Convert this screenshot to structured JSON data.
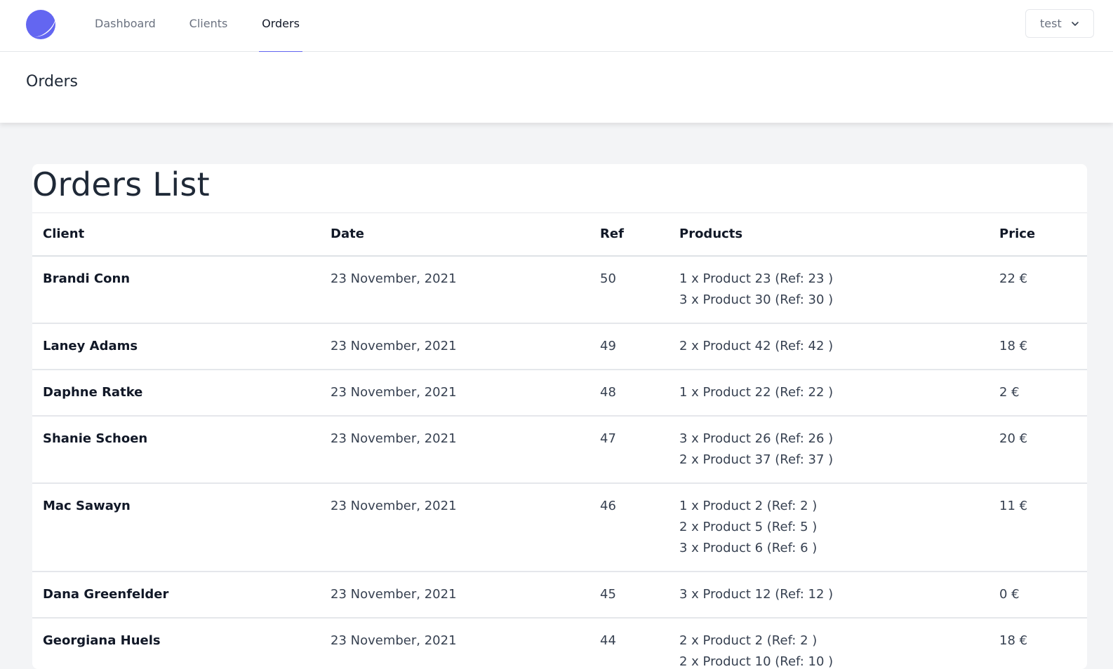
{
  "nav": {
    "links": [
      {
        "label": "Dashboard",
        "active": false
      },
      {
        "label": "Clients",
        "active": false
      },
      {
        "label": "Orders",
        "active": true
      }
    ],
    "user": {
      "label": "test",
      "icon": "chevron-down-icon"
    },
    "logo_icon": "app-logo-icon",
    "accent_color": "#6366f1"
  },
  "header": {
    "title": "Orders"
  },
  "orders": {
    "title": "Orders List",
    "columns": [
      "Client",
      "Date",
      "Ref",
      "Products",
      "Price"
    ],
    "rows": [
      {
        "client": "Brandi Conn",
        "date": "23 November, 2021",
        "ref": "50",
        "products": [
          "1 x Product 23 (Ref: 23 )",
          "3 x Product 30 (Ref: 30 )"
        ],
        "price": "22 €"
      },
      {
        "client": "Laney Adams",
        "date": "23 November, 2021",
        "ref": "49",
        "products": [
          "2 x Product 42 (Ref: 42 )"
        ],
        "price": "18 €"
      },
      {
        "client": "Daphne Ratke",
        "date": "23 November, 2021",
        "ref": "48",
        "products": [
          "1 x Product 22 (Ref: 22 )"
        ],
        "price": "2 €"
      },
      {
        "client": "Shanie Schoen",
        "date": "23 November, 2021",
        "ref": "47",
        "products": [
          "3 x Product 26 (Ref: 26 )",
          "2 x Product 37 (Ref: 37 )"
        ],
        "price": "20 €"
      },
      {
        "client": "Mac Sawayn",
        "date": "23 November, 2021",
        "ref": "46",
        "products": [
          "1 x Product 2 (Ref: 2 )",
          "2 x Product 5 (Ref: 5 )",
          "3 x Product 6 (Ref: 6 )"
        ],
        "price": "11 €"
      },
      {
        "client": "Dana Greenfelder",
        "date": "23 November, 2021",
        "ref": "45",
        "products": [
          "3 x Product 12 (Ref: 12 )"
        ],
        "price": "0 €"
      },
      {
        "client": "Georgiana Huels",
        "date": "23 November, 2021",
        "ref": "44",
        "products": [
          "2 x Product 2 (Ref: 2 )",
          "2 x Product 10 (Ref: 10 )"
        ],
        "price": "18 €"
      }
    ]
  }
}
